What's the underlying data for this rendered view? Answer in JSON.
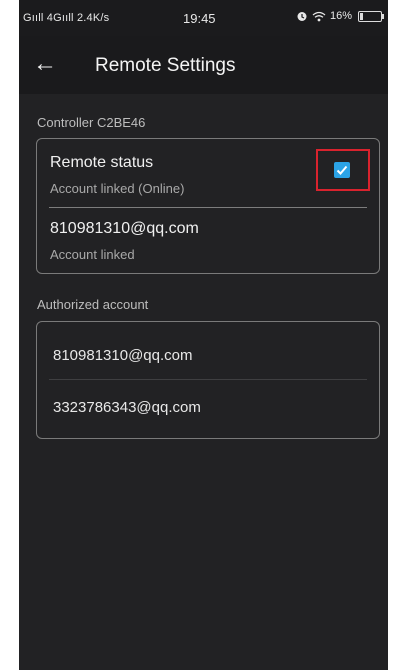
{
  "status_bar": {
    "signal_text": "Gııll 4Gııll 2.4K/s",
    "time": "19:45",
    "battery": "16%"
  },
  "header": {
    "title": "Remote Settings",
    "back_icon": "back-arrow-icon"
  },
  "controller": {
    "label": "Controller  C2BE46"
  },
  "remote_card": {
    "status_title": "Remote status",
    "status_sub": "Account linked (Online)",
    "checked": true,
    "account": "810981310@qq.com",
    "account_sub": "Account linked"
  },
  "authorized": {
    "label": "Authorized account",
    "accounts": [
      "810981310@qq.com",
      "3323786343@qq.com"
    ]
  },
  "colors": {
    "accent": "#2ba3e6",
    "highlight": "#d9232e",
    "background": "#222224"
  }
}
